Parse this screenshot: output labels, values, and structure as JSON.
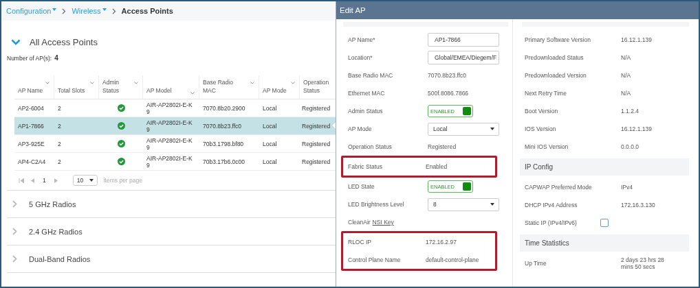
{
  "breadcrumb": [
    {
      "label": "Configuration",
      "dropdown": true
    },
    {
      "label": "Wireless",
      "dropdown": true
    },
    {
      "label": "Access Points",
      "dropdown": false
    }
  ],
  "section": {
    "title": "All Access Points",
    "expanded": true,
    "count_label": "Number of AP(s):",
    "count": "4"
  },
  "table": {
    "columns": [
      {
        "label": "AP Name",
        "sortable": true
      },
      {
        "label": "Total Slots",
        "sortable": true
      },
      {
        "label": "Admin Status",
        "sortable": true
      },
      {
        "label": "AP Model",
        "sortable": true
      },
      {
        "label": "Base Radio MAC",
        "sortable": true
      },
      {
        "label": "AP Mode",
        "sortable": true
      },
      {
        "label": "Operation Status",
        "sortable": false
      }
    ],
    "rows": [
      {
        "name": "AP2-6004",
        "slots": "2",
        "admin_ok": true,
        "model": "AIR-AP2802I-E-K9",
        "mac": "7070.8b20.2900",
        "mode": "Local",
        "status": "Registered",
        "selected": false
      },
      {
        "name": "AP1-7866",
        "slots": "2",
        "admin_ok": true,
        "model": "AIR-AP2802I-E-K9",
        "mac": "7070.8b23.ffc0",
        "mode": "Local",
        "status": "Registered",
        "selected": true
      },
      {
        "name": "AP3-925E",
        "slots": "2",
        "admin_ok": true,
        "model": "AIR-AP2802I-E-K9",
        "mac": "70b3.1798.bf80",
        "mode": "Local",
        "status": "Registered",
        "selected": false
      },
      {
        "name": "AP4-C2A4",
        "slots": "2",
        "admin_ok": true,
        "model": "AIR-AP2802I-E-K9",
        "mac": "70b3.17b6.0c00",
        "mode": "Local",
        "status": "Registered",
        "selected": false
      }
    ]
  },
  "pagination": {
    "page": "1",
    "page_size": "10",
    "per_page_label": "items per page"
  },
  "collapsed_sections": [
    {
      "title": "5 GHz Radios",
      "expanded": false
    },
    {
      "title": "2.4 GHz Radios",
      "expanded": false
    },
    {
      "title": "Dual-Band Radios",
      "expanded": false
    }
  ],
  "modal": {
    "title": "Edit AP",
    "left": [
      {
        "highlighted": false,
        "fields": [
          {
            "kind": "input",
            "label": "AP Name*",
            "value": "AP1-7866"
          },
          {
            "kind": "input",
            "label": "Location*",
            "value": "Global/EMEA/Diegem/F"
          },
          {
            "kind": "text",
            "label": "Base Radio MAC",
            "value": "7070.8b23.ffc0"
          },
          {
            "kind": "text",
            "label": "Ethernet MAC",
            "value": "500f.8086.7866"
          },
          {
            "kind": "toggle",
            "label": "Admin Status",
            "value": "ENABLED",
            "on": true
          },
          {
            "kind": "select",
            "label": "AP Mode",
            "value": "Local"
          },
          {
            "kind": "text",
            "label": "Operation Status",
            "value": "Registered"
          }
        ]
      },
      {
        "highlighted": true,
        "fields": [
          {
            "kind": "text",
            "label": "Fabric Status",
            "value": "Enabled"
          }
        ]
      },
      {
        "highlighted": false,
        "fields": [
          {
            "kind": "toggle",
            "label": "LED State",
            "value": "ENABLED",
            "on": true
          },
          {
            "kind": "select",
            "label": "LED Brightness Level",
            "value": "8"
          },
          {
            "kind": "link",
            "label": "CleanAir",
            "value": "NSI Key"
          }
        ]
      },
      {
        "highlighted": true,
        "fields": [
          {
            "kind": "text",
            "label": "RLOC IP",
            "value": "172.16.2.97"
          },
          {
            "kind": "text",
            "label": "Control Plane Name",
            "value": "default-control-plane"
          }
        ]
      }
    ],
    "right": [
      {
        "kind": "text",
        "label": "Primary Software Version",
        "value": "16.12.1.139"
      },
      {
        "kind": "text",
        "label": "Predownloaded Status",
        "value": "N/A"
      },
      {
        "kind": "text",
        "label": "Predownloaded Version",
        "value": "N/A"
      },
      {
        "kind": "text",
        "label": "Next Retry Time",
        "value": "N/A"
      },
      {
        "kind": "text",
        "label": "Boot Version",
        "value": "1.1.2.4"
      },
      {
        "kind": "text",
        "label": "IOS Version",
        "value": "16.12.1.139"
      },
      {
        "kind": "text",
        "label": "Mini IOS Version",
        "value": "0.0.0.0"
      },
      {
        "kind": "section",
        "label": "IP Config"
      },
      {
        "kind": "text",
        "label": "CAPWAP Preferred Mode",
        "value": "IPv4"
      },
      {
        "kind": "text",
        "label": "DHCP IPv4 Address",
        "value": "172.16.3.130"
      },
      {
        "kind": "checkbox",
        "label": "Static IP (IPv4/IPv6)",
        "checked": false
      },
      {
        "kind": "section",
        "label": "Time Statistics"
      },
      {
        "kind": "text",
        "label": "Up Time",
        "value": "2 days 23 hrs 28 mins 50 secs"
      }
    ]
  }
}
